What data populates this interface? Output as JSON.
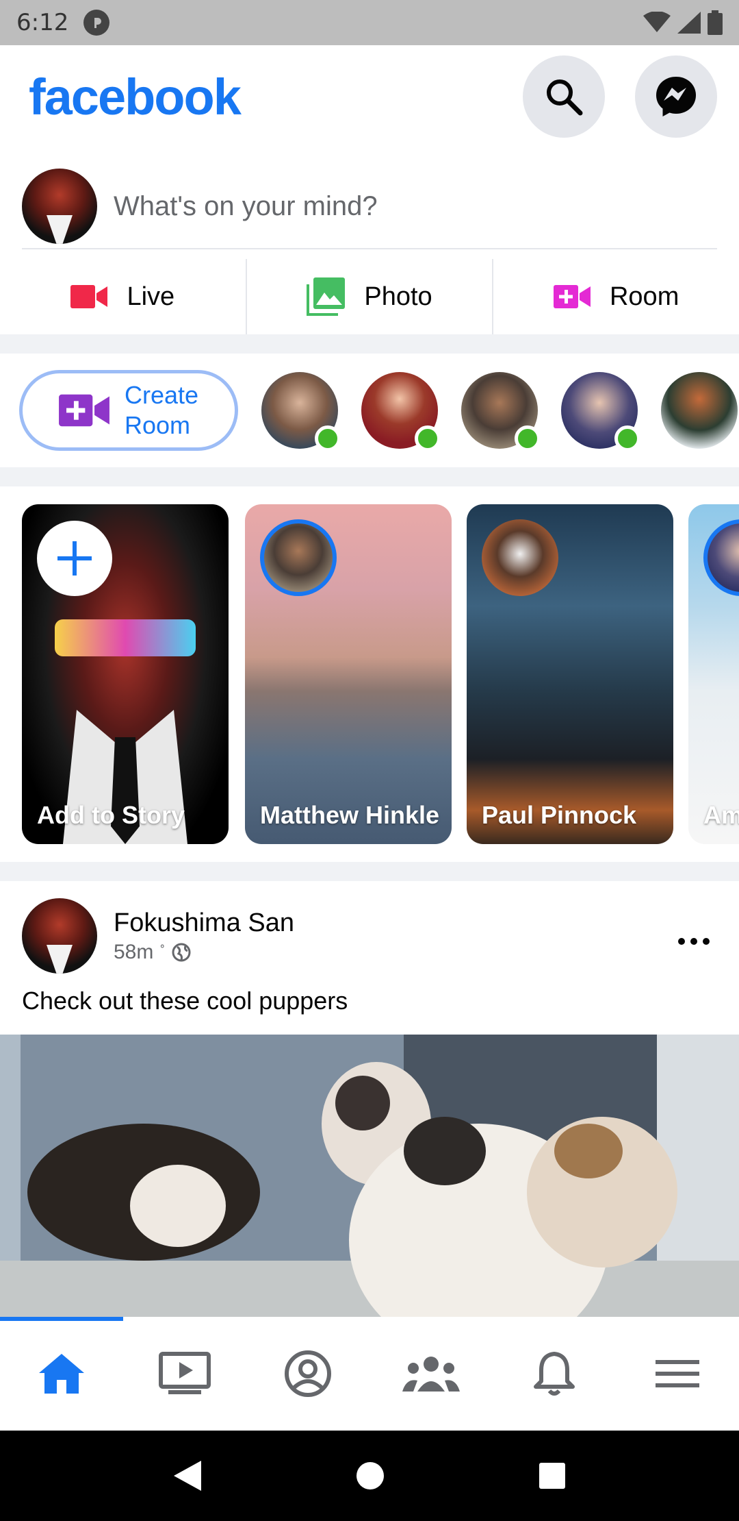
{
  "status_bar": {
    "time": "6:12"
  },
  "header": {
    "logo": "facebook"
  },
  "composer": {
    "placeholder": "What's on your mind?"
  },
  "actions": [
    {
      "label": "Live",
      "icon": "video-camera-icon",
      "color": "#f02849"
    },
    {
      "label": "Photo",
      "icon": "photo-gallery-icon",
      "color": "#45bd62"
    },
    {
      "label": "Room",
      "icon": "video-plus-icon",
      "color": "#e42ad4"
    }
  ],
  "rooms": {
    "create_label_line1": "Create",
    "create_label_line2": "Room"
  },
  "stories": {
    "add_label": "Add to Story",
    "items": [
      {
        "name": "Matthew Hinkle"
      },
      {
        "name": "Paul Pinnock"
      },
      {
        "name": "Am"
      }
    ]
  },
  "post": {
    "author": "Fokushima San",
    "time": "58m",
    "text": "Check out these cool puppers"
  },
  "colors": {
    "brand": "#1877f2",
    "online": "#42b72a"
  }
}
